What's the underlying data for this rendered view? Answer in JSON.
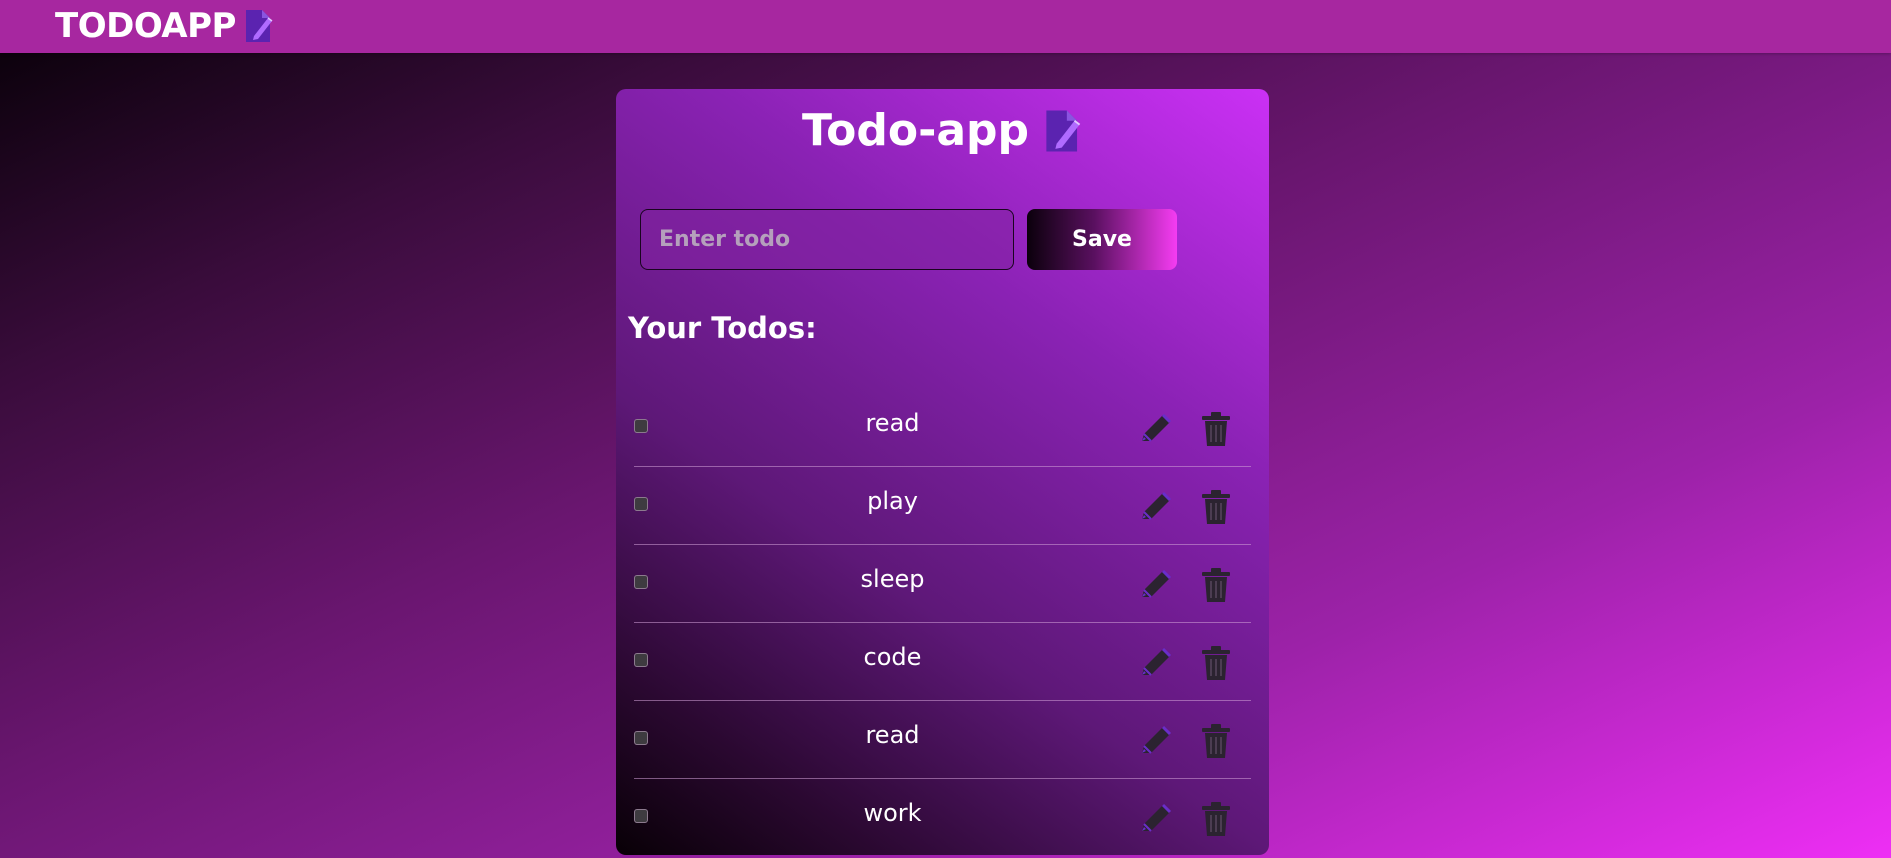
{
  "navbar": {
    "brand": "TODOAPP",
    "brand_icon": "note-pen-icon"
  },
  "card": {
    "title": "Todo-app",
    "title_icon": "note-pen-icon",
    "input": {
      "placeholder": "Enter todo",
      "value": ""
    },
    "save_label": "Save",
    "section_title": "Your Todos:"
  },
  "todos": [
    {
      "text": "read",
      "done": false
    },
    {
      "text": "play",
      "done": false
    },
    {
      "text": "sleep",
      "done": false
    },
    {
      "text": "code",
      "done": false
    },
    {
      "text": "read",
      "done": false
    },
    {
      "text": "work",
      "done": false
    }
  ],
  "colors": {
    "navbar": "#a727a0",
    "accent": "#cb30f5",
    "icon_purple": "#6a2dc9",
    "icon_dark": "#2b2330"
  }
}
